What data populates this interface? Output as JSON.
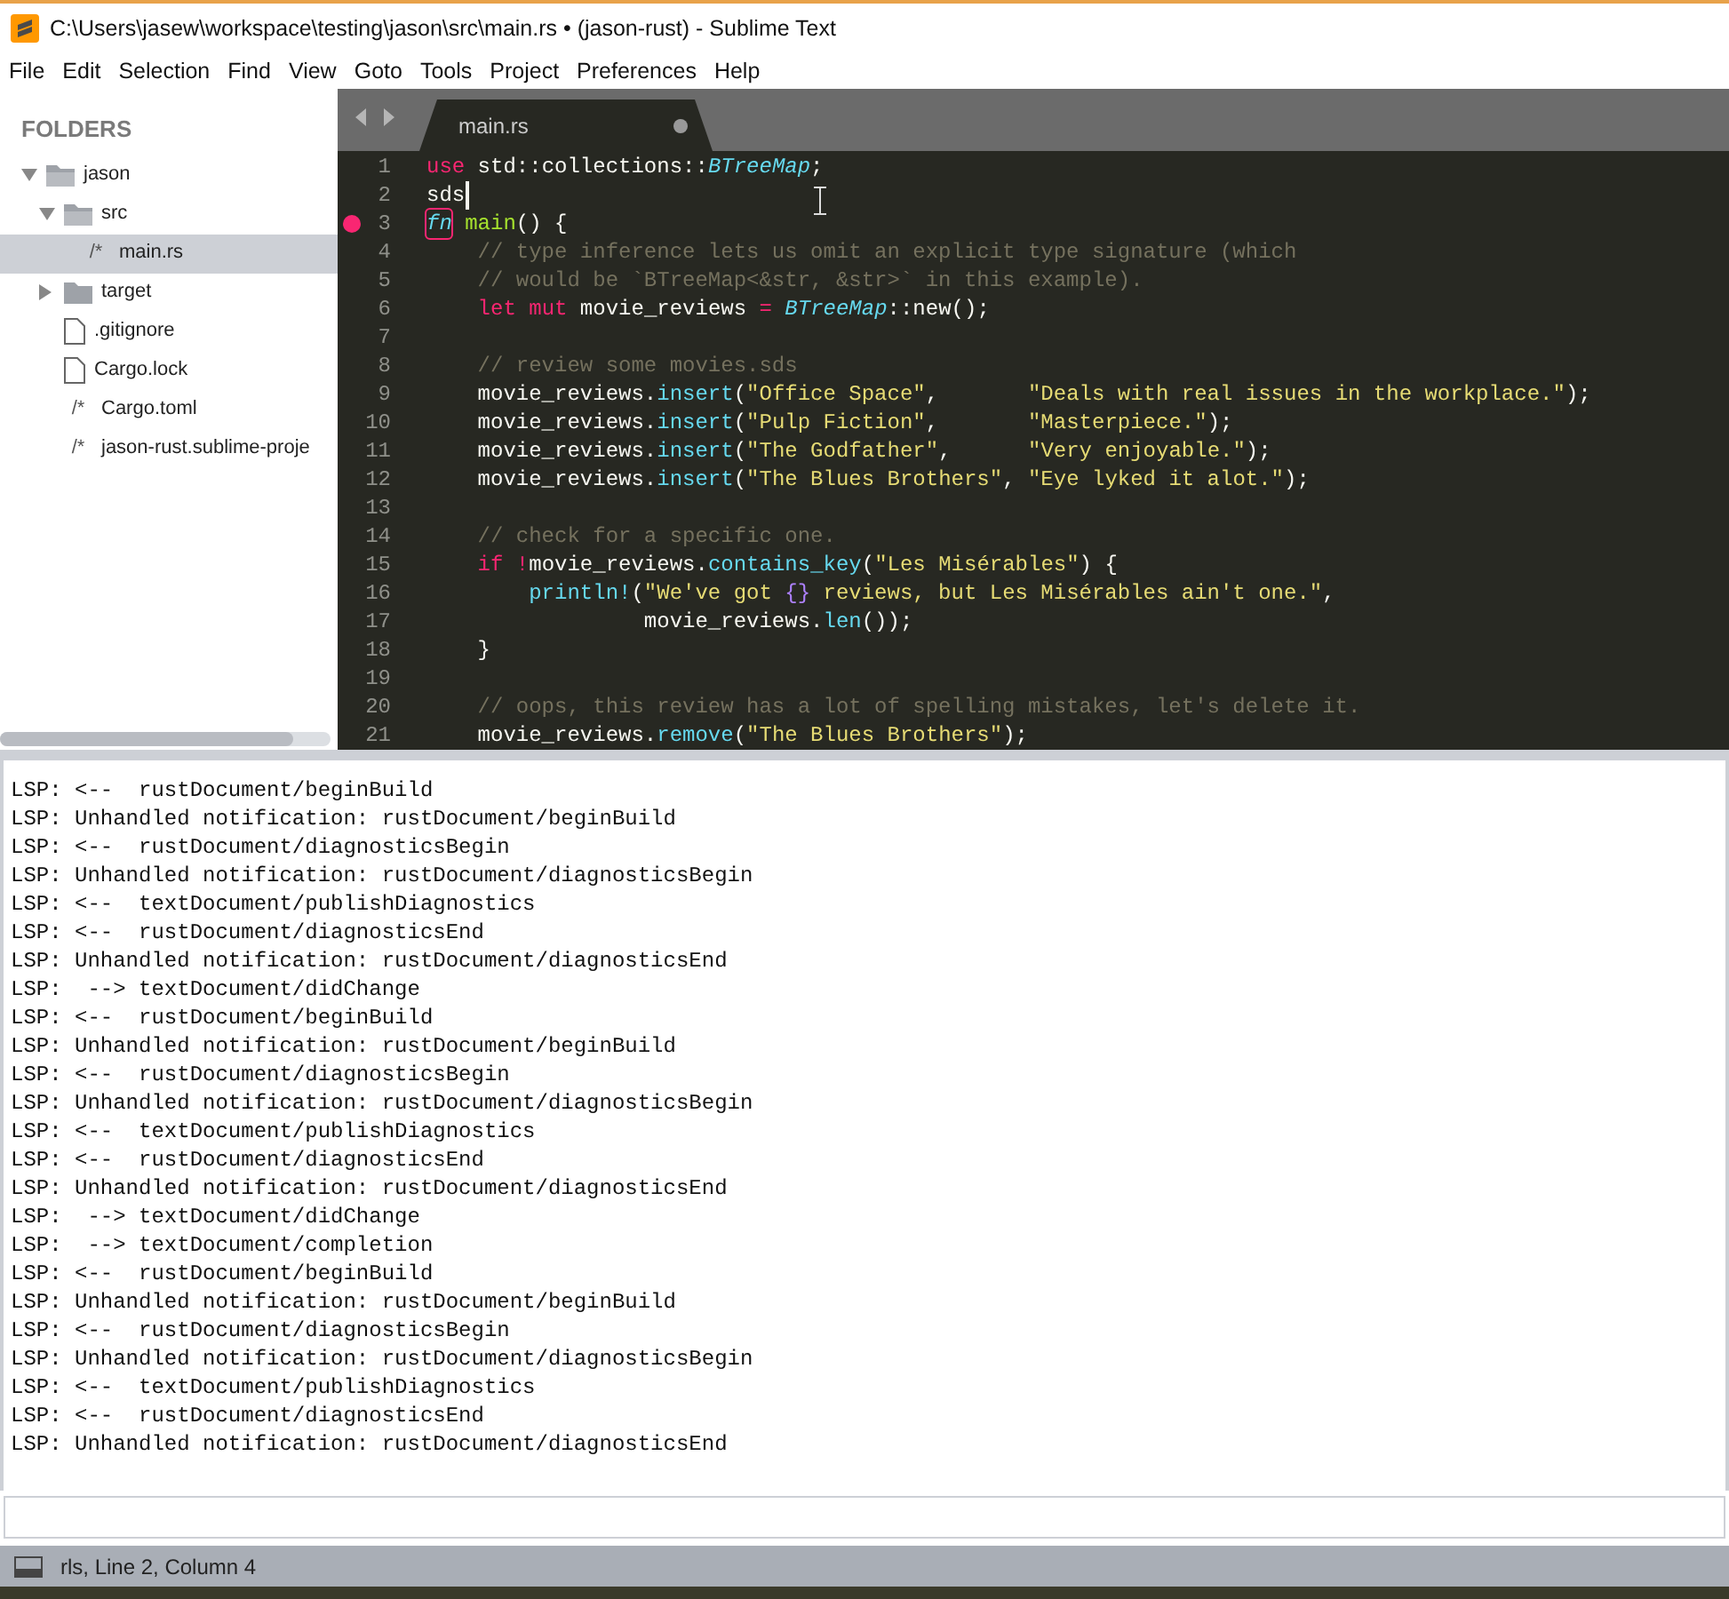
{
  "window": {
    "title": "C:\\Users\\jasew\\workspace\\testing\\jason\\src\\main.rs • (jason-rust) - Sublime Text"
  },
  "menu": [
    "File",
    "Edit",
    "Selection",
    "Find",
    "View",
    "Goto",
    "Tools",
    "Project",
    "Preferences",
    "Help"
  ],
  "sidebar": {
    "heading": "FOLDERS",
    "items": [
      {
        "label": "jason",
        "kind": "folder",
        "expanded": true,
        "selected": false,
        "children": [
          {
            "label": "src",
            "kind": "folder",
            "expanded": true,
            "selected": false,
            "children": [
              {
                "label": "main.rs",
                "kind": "code",
                "glyph": "/*",
                "selected": true
              }
            ]
          },
          {
            "label": "target",
            "kind": "folder",
            "expanded": false,
            "selected": false
          },
          {
            "label": ".gitignore",
            "kind": "file",
            "selected": false
          },
          {
            "label": "Cargo.lock",
            "kind": "file",
            "selected": false
          },
          {
            "label": "Cargo.toml",
            "kind": "code",
            "glyph": "/*",
            "selected": false
          },
          {
            "label": "jason-rust.sublime-proje",
            "kind": "code",
            "glyph": "/*",
            "selected": false
          }
        ]
      }
    ]
  },
  "tabs": [
    {
      "label": "main.rs",
      "selected": true,
      "modified": true
    }
  ],
  "editor": {
    "lines": [
      {
        "number": "1",
        "tokens": [
          {
            "kind": "keyword",
            "text": "use"
          },
          {
            "kind": "plain",
            "text": " std::collections::"
          },
          {
            "kind": "type",
            "text": "BTreeMap"
          },
          {
            "kind": "plain",
            "text": ";"
          }
        ]
      },
      {
        "number": "2",
        "caret": true,
        "tokens": [
          {
            "kind": "plain",
            "text": "sds"
          }
        ]
      },
      {
        "number": "3",
        "breakpoint": true,
        "tokens": [
          {
            "kind": "storage",
            "text": "fn"
          },
          {
            "kind": "function",
            "text": " main"
          },
          {
            "kind": "plain",
            "text": "() {"
          }
        ]
      },
      {
        "number": "4",
        "tokens": [
          {
            "kind": "comment",
            "text": "    // type inference lets us omit an explicit type signature (which"
          }
        ]
      },
      {
        "number": "5",
        "tokens": [
          {
            "kind": "comment",
            "text": "    // would be `BTreeMap<&str, &str>` in this example)."
          }
        ]
      },
      {
        "number": "6",
        "tokens": [
          {
            "kind": "keyword",
            "text": "    let"
          },
          {
            "kind": "keyword",
            "text": " mut"
          },
          {
            "kind": "plain",
            "text": " movie_reviews "
          },
          {
            "kind": "keyword",
            "text": "="
          },
          {
            "kind": "type",
            "text": " BTreeMap"
          },
          {
            "kind": "plain",
            "text": "::new();"
          }
        ]
      },
      {
        "number": "7"
      },
      {
        "number": "8",
        "tokens": [
          {
            "kind": "comment",
            "text": "    // review some movies.sds"
          }
        ]
      },
      {
        "number": "9",
        "tokens": [
          {
            "kind": "plain",
            "text": "    movie_reviews."
          },
          {
            "kind": "call",
            "text": "insert"
          },
          {
            "kind": "plain",
            "text": "("
          },
          {
            "kind": "string",
            "text": "\"Office Space\""
          },
          {
            "kind": "plain",
            "text": ",       "
          },
          {
            "kind": "string",
            "text": "\"Deals with real issues in the workplace.\""
          },
          {
            "kind": "plain",
            "text": ");"
          }
        ]
      },
      {
        "number": "10",
        "tokens": [
          {
            "kind": "plain",
            "text": "    movie_reviews."
          },
          {
            "kind": "call",
            "text": "insert"
          },
          {
            "kind": "plain",
            "text": "("
          },
          {
            "kind": "string",
            "text": "\"Pulp Fiction\""
          },
          {
            "kind": "plain",
            "text": ",       "
          },
          {
            "kind": "string",
            "text": "\"Masterpiece.\""
          },
          {
            "kind": "plain",
            "text": ");"
          }
        ]
      },
      {
        "number": "11",
        "tokens": [
          {
            "kind": "plain",
            "text": "    movie_reviews."
          },
          {
            "kind": "call",
            "text": "insert"
          },
          {
            "kind": "plain",
            "text": "("
          },
          {
            "kind": "string",
            "text": "\"The Godfather\""
          },
          {
            "kind": "plain",
            "text": ",      "
          },
          {
            "kind": "string",
            "text": "\"Very enjoyable.\""
          },
          {
            "kind": "plain",
            "text": ");"
          }
        ]
      },
      {
        "number": "12",
        "tokens": [
          {
            "kind": "plain",
            "text": "    movie_reviews."
          },
          {
            "kind": "call",
            "text": "insert"
          },
          {
            "kind": "plain",
            "text": "("
          },
          {
            "kind": "string",
            "text": "\"The Blues Brothers\""
          },
          {
            "kind": "plain",
            "text": ", "
          },
          {
            "kind": "string",
            "text": "\"Eye lyked it alot.\""
          },
          {
            "kind": "plain",
            "text": ");"
          }
        ]
      },
      {
        "number": "13"
      },
      {
        "number": "14",
        "tokens": [
          {
            "kind": "comment",
            "text": "    // check for a specific one."
          }
        ]
      },
      {
        "number": "15",
        "tokens": [
          {
            "kind": "keyword",
            "text": "    if"
          },
          {
            "kind": "keyword",
            "text": " !"
          },
          {
            "kind": "plain",
            "text": "movie_reviews."
          },
          {
            "kind": "call",
            "text": "contains_key"
          },
          {
            "kind": "plain",
            "text": "("
          },
          {
            "kind": "string",
            "text": "\"Les Misérables\""
          },
          {
            "kind": "plain",
            "text": ") {"
          }
        ]
      },
      {
        "number": "16",
        "tokens": [
          {
            "kind": "call",
            "text": "        println!"
          },
          {
            "kind": "plain",
            "text": "("
          },
          {
            "kind": "string",
            "text": "\"We've got "
          },
          {
            "kind": "placeholder",
            "text": "{}"
          },
          {
            "kind": "string",
            "text": " reviews, but Les Misérables ain't one.\""
          },
          {
            "kind": "plain",
            "text": ","
          }
        ]
      },
      {
        "number": "17",
        "tokens": [
          {
            "kind": "plain",
            "text": "                 movie_reviews."
          },
          {
            "kind": "call",
            "text": "len"
          },
          {
            "kind": "plain",
            "text": "());"
          }
        ]
      },
      {
        "number": "18",
        "tokens": [
          {
            "kind": "plain",
            "text": "    }"
          }
        ]
      },
      {
        "number": "19"
      },
      {
        "number": "20",
        "tokens": [
          {
            "kind": "comment",
            "text": "    // oops, this review has a lot of spelling mistakes, let's delete it."
          }
        ]
      },
      {
        "number": "21",
        "tokens": [
          {
            "kind": "plain",
            "text": "    movie_reviews."
          },
          {
            "kind": "call",
            "text": "remove"
          },
          {
            "kind": "plain",
            "text": "("
          },
          {
            "kind": "string",
            "text": "\"The Blues Brothers\""
          },
          {
            "kind": "plain",
            "text": ");"
          }
        ]
      }
    ]
  },
  "console": {
    "lines": [
      "LSP: <--  rustDocument/beginBuild",
      "LSP: Unhandled notification: rustDocument/beginBuild",
      "LSP: <--  rustDocument/diagnosticsBegin",
      "LSP: Unhandled notification: rustDocument/diagnosticsBegin",
      "LSP: <--  textDocument/publishDiagnostics",
      "LSP: <--  rustDocument/diagnosticsEnd",
      "LSP: Unhandled notification: rustDocument/diagnosticsEnd",
      "LSP:  --> textDocument/didChange",
      "LSP: <--  rustDocument/beginBuild",
      "LSP: Unhandled notification: rustDocument/beginBuild",
      "LSP: <--  rustDocument/diagnosticsBegin",
      "LSP: Unhandled notification: rustDocument/diagnosticsBegin",
      "LSP: <--  textDocument/publishDiagnostics",
      "LSP: <--  rustDocument/diagnosticsEnd",
      "LSP: Unhandled notification: rustDocument/diagnosticsEnd",
      "LSP:  --> textDocument/didChange",
      "LSP:  --> textDocument/completion",
      "LSP: <--  rustDocument/beginBuild",
      "LSP: Unhandled notification: rustDocument/beginBuild",
      "LSP: <--  rustDocument/diagnosticsBegin",
      "LSP: Unhandled notification: rustDocument/diagnosticsBegin",
      "LSP: <--  textDocument/publishDiagnostics",
      "LSP: <--  rustDocument/diagnosticsEnd",
      "LSP: Unhandled notification: rustDocument/diagnosticsEnd"
    ]
  },
  "status_bar": {
    "text": "rls, Line 2, Column 4"
  }
}
